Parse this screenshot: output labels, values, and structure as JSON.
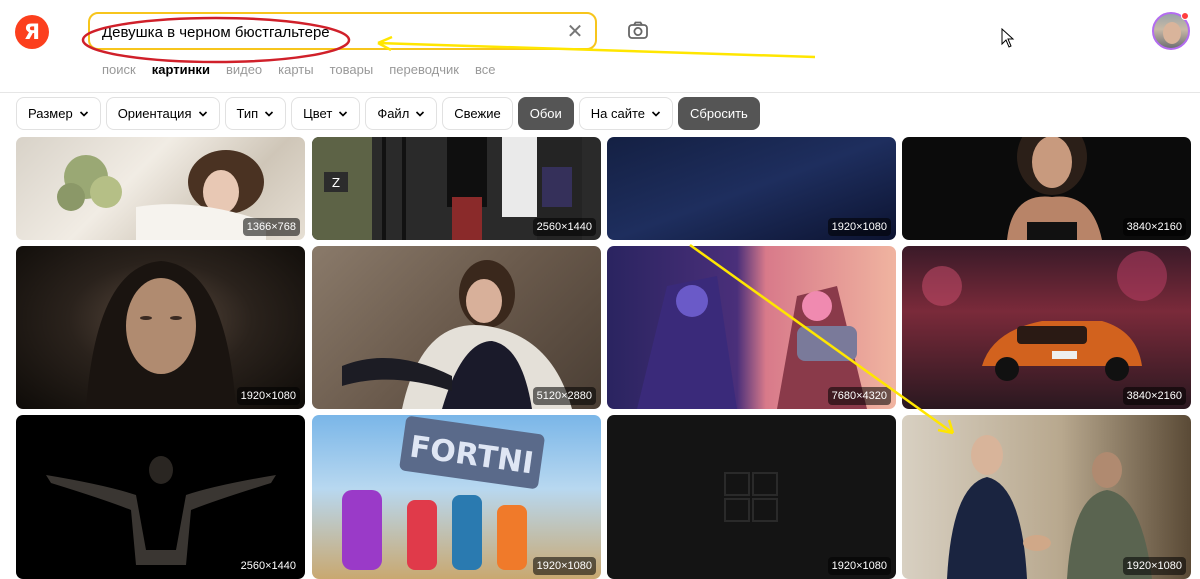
{
  "logo": {
    "text": "Я"
  },
  "search": {
    "value": "Девушка в черном бюстгальтере",
    "clear_symbol": "✕"
  },
  "tabs": [
    {
      "label": "поиск",
      "active": false
    },
    {
      "label": "картинки",
      "active": true
    },
    {
      "label": "видео",
      "active": false
    },
    {
      "label": "карты",
      "active": false
    },
    {
      "label": "товары",
      "active": false
    },
    {
      "label": "переводчик",
      "active": false
    },
    {
      "label": "все",
      "active": false
    }
  ],
  "filters": [
    {
      "label": "Размер",
      "dropdown": true,
      "dark": false
    },
    {
      "label": "Ориентация",
      "dropdown": true,
      "dark": false
    },
    {
      "label": "Тип",
      "dropdown": true,
      "dark": false
    },
    {
      "label": "Цвет",
      "dropdown": true,
      "dark": false
    },
    {
      "label": "Файл",
      "dropdown": true,
      "dark": false
    },
    {
      "label": "Свежие",
      "dropdown": false,
      "dark": false
    },
    {
      "label": "Обои",
      "dropdown": false,
      "dark": true
    },
    {
      "label": "На сайте",
      "dropdown": true,
      "dark": false
    },
    {
      "label": "Сбросить",
      "dropdown": false,
      "dark": true
    }
  ],
  "results": [
    {
      "resolution": "1366×768",
      "subject": "woman-flowers"
    },
    {
      "resolution": "2560×1440",
      "subject": "soldiers"
    },
    {
      "resolution": "1920×1080",
      "subject": "dark-blue"
    },
    {
      "resolution": "3840×2160",
      "subject": "woman-portrait"
    },
    {
      "resolution": "1920×1080",
      "subject": "hooded-woman"
    },
    {
      "resolution": "5120×2880",
      "subject": "woman-jacket"
    },
    {
      "resolution": "7680×4320",
      "subject": "game-characters"
    },
    {
      "resolution": "3840×2160",
      "subject": "orange-car"
    },
    {
      "resolution": "2560×1440",
      "subject": "muscular-back"
    },
    {
      "resolution": "1920×1080",
      "subject": "fortnite-art"
    },
    {
      "resolution": "1920×1080",
      "subject": "windows-logo"
    },
    {
      "resolution": "1920×1080",
      "subject": "handshake"
    }
  ],
  "colors": {
    "logo": "#fc3f1d",
    "search_border": "#f7c51c",
    "annotation_red": "#d0202a",
    "annotation_yellow": "#ffe600",
    "dark_chip": "#555555"
  }
}
